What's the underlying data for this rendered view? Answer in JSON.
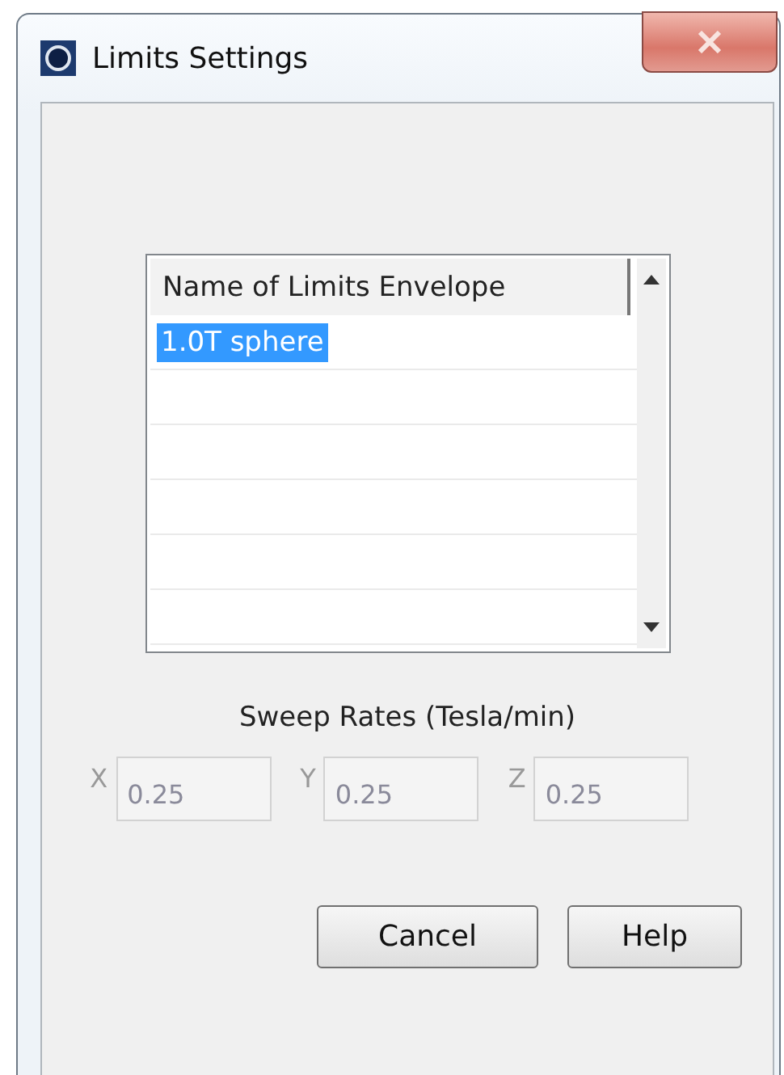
{
  "window": {
    "title": "Limits Settings"
  },
  "list": {
    "column": "Name of Limits Envelope",
    "rows": [
      {
        "name": "1.0T sphere",
        "selected": true
      }
    ]
  },
  "sweep_rates": {
    "label": "Sweep Rates (Tesla/min)",
    "fields": [
      {
        "axis": "X",
        "value": "0.25",
        "disabled": true
      },
      {
        "axis": "Y",
        "value": "0.25",
        "disabled": true
      },
      {
        "axis": "Z",
        "value": "0.25",
        "disabled": true
      }
    ]
  },
  "buttons": [
    "Cancel",
    "Help"
  ]
}
